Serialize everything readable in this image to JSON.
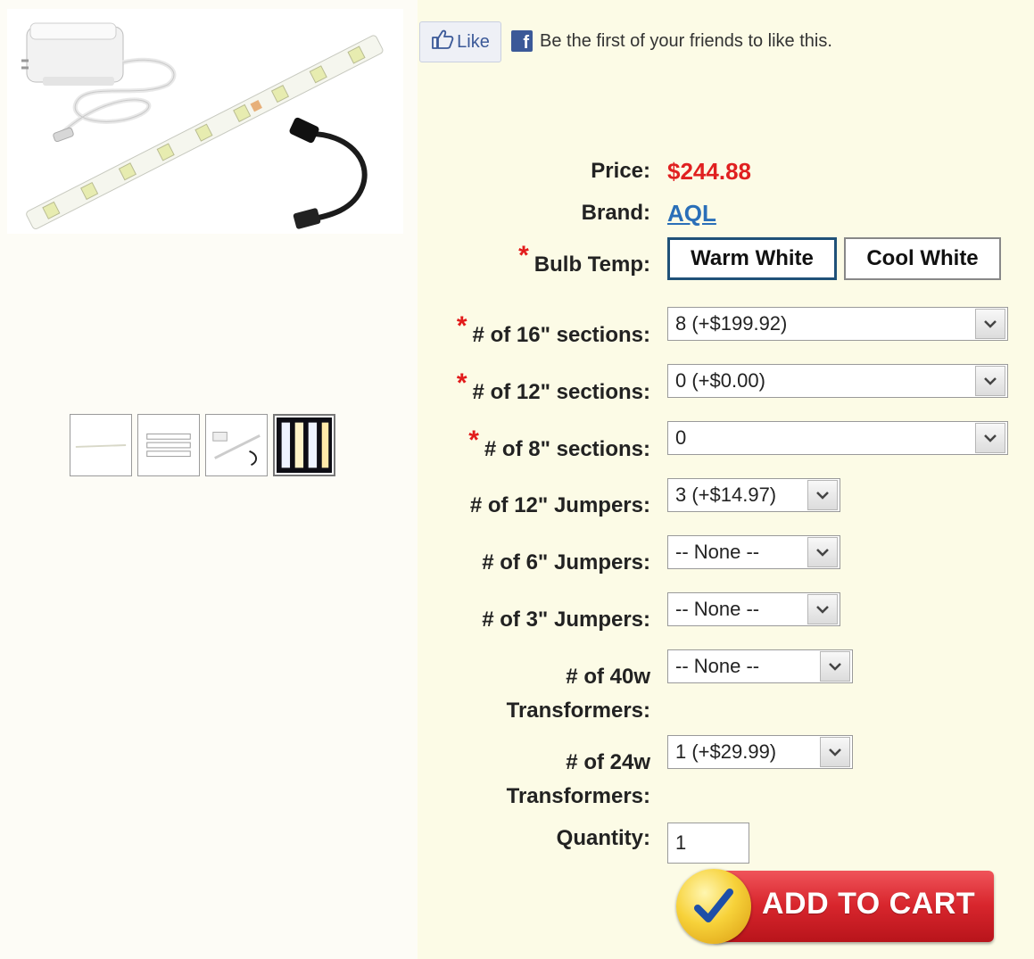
{
  "social": {
    "like_label": "Like",
    "friends_text": "Be the first of your friends to like this.",
    "facebook_glyph": "f"
  },
  "product": {
    "price_label": "Price:",
    "price": "$244.88",
    "brand_label": "Brand:",
    "brand": "AQL"
  },
  "options": {
    "bulb_temp": {
      "label": "Bulb Temp:",
      "choices": [
        "Warm White",
        "Cool White"
      ],
      "selected": "Warm White"
    },
    "sections_16": {
      "label": "# of 16\" sections:",
      "value": "8 (+$199.92)"
    },
    "sections_12": {
      "label": "# of 12\" sections:",
      "value": "0 (+$0.00)"
    },
    "sections_8": {
      "label": "# of 8\" sections:",
      "value": "0"
    },
    "jumpers_12": {
      "label": "# of 12\" Jumpers:",
      "value": "3 (+$14.97)"
    },
    "jumpers_6": {
      "label": "# of 6\" Jumpers:",
      "value": "-- None --"
    },
    "jumpers_3": {
      "label": "# of 3\" Jumpers:",
      "value": "-- None --"
    },
    "transformers_40w": {
      "label_line1": "# of 40w",
      "label_line2": "Transformers:",
      "value": "-- None --"
    },
    "transformers_24w": {
      "label_line1": "# of 24w",
      "label_line2": "Transformers:",
      "value": "1 (+$29.99)"
    },
    "quantity": {
      "label": "Quantity:",
      "value": "1"
    }
  },
  "required_marker": "*",
  "cart": {
    "label": "ADD TO CART"
  },
  "colors": {
    "price": "#e02020",
    "link": "#2a6fb8",
    "required": "#e21b1b",
    "cart_red": "#d8262d",
    "facebook_blue": "#3b5998"
  },
  "icons": [
    "thumbs-up-icon",
    "facebook-icon",
    "dropdown-arrow-icon",
    "checkmark-icon"
  ]
}
